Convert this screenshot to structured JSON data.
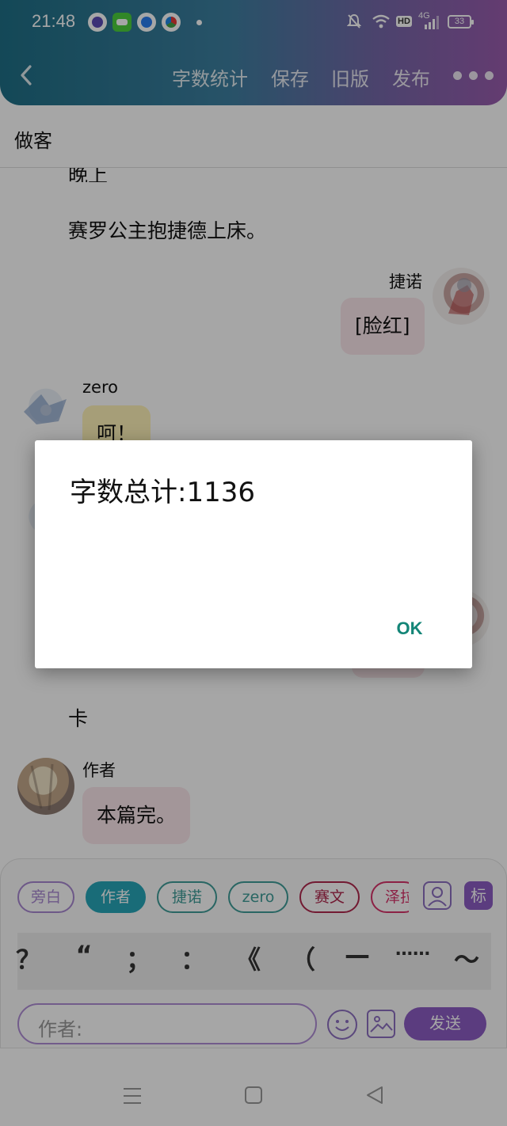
{
  "status_bar": {
    "time": "21:48",
    "network": "4G",
    "hd": "HD",
    "battery": "33"
  },
  "header": {
    "actions": [
      "字数统计",
      "保存",
      "旧版",
      "发布"
    ]
  },
  "site_name": "做客",
  "chat": {
    "narration_top_partial": "晚上",
    "narration_1": "赛罗公主抱捷德上床。",
    "msg_1": {
      "speaker": "捷诺",
      "text": "[脸红]"
    },
    "msg_2": {
      "speaker": "zero",
      "text": "呵！"
    },
    "narration_2": "卡",
    "msg_3": {
      "speaker": "作者",
      "text": "本篇完。"
    }
  },
  "role_chips": [
    {
      "label": "旁白",
      "color": "#a887d1"
    },
    {
      "label": "作者",
      "color": "#27a7b8"
    },
    {
      "label": "捷诺",
      "color": "#3f9d98"
    },
    {
      "label": "zero",
      "color": "#3f9d98"
    },
    {
      "label": "赛文",
      "color": "#b0284e"
    },
    {
      "label": "泽拉",
      "color": "#d8336a"
    }
  ],
  "tag_button": "标",
  "punctuation": [
    "？",
    "“",
    "；",
    "：",
    "《",
    "（",
    "—",
    "……",
    "～"
  ],
  "input": {
    "placeholder": "作者:"
  },
  "send_label": "发送",
  "dialog": {
    "message": "字数总计:1136",
    "ok_label": "OK"
  }
}
